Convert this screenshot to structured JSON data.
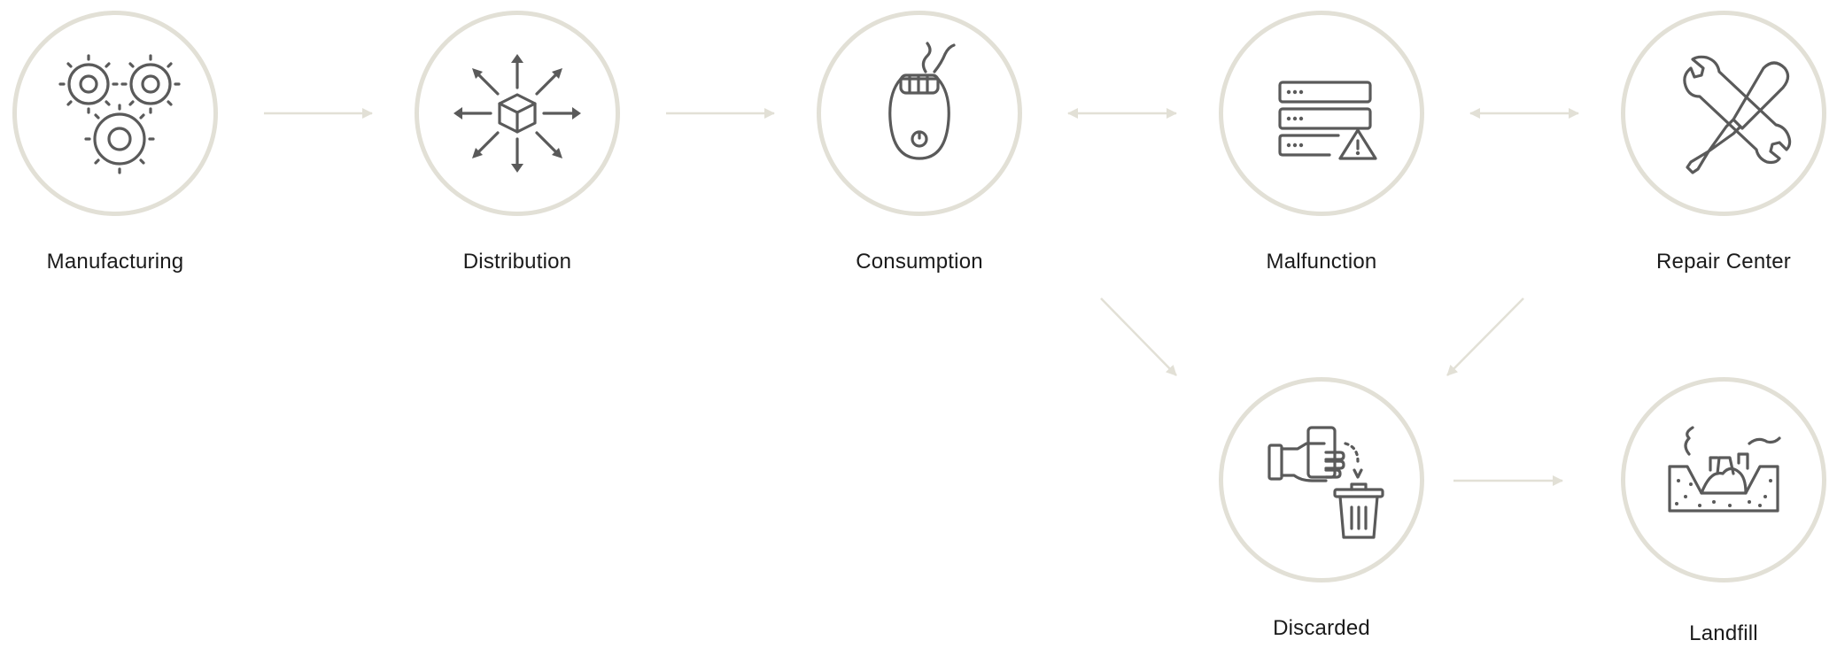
{
  "nodes": [
    {
      "id": "manufacturing",
      "label": "Manufacturing",
      "icon": "gears-icon"
    },
    {
      "id": "distribution",
      "label": "Distribution",
      "icon": "box-distribution-icon"
    },
    {
      "id": "consumption",
      "label": "Consumption",
      "icon": "epilator-icon"
    },
    {
      "id": "malfunction",
      "label": "Malfunction",
      "icon": "server-warning-icon"
    },
    {
      "id": "repair",
      "label": "Repair Center",
      "icon": "wrench-screwdriver-icon"
    },
    {
      "id": "discarded",
      "label": "Discarded",
      "icon": "hand-trash-icon"
    },
    {
      "id": "landfill",
      "label": "Landfill",
      "icon": "landfill-icon"
    }
  ],
  "edges": [
    {
      "from": "manufacturing",
      "to": "distribution",
      "type": "one-way"
    },
    {
      "from": "distribution",
      "to": "consumption",
      "type": "one-way"
    },
    {
      "from": "consumption",
      "to": "malfunction",
      "type": "two-way"
    },
    {
      "from": "malfunction",
      "to": "repair",
      "type": "two-way"
    },
    {
      "from": "consumption",
      "to": "discarded",
      "type": "one-way"
    },
    {
      "from": "repair",
      "to": "discarded",
      "type": "one-way"
    },
    {
      "from": "discarded",
      "to": "landfill",
      "type": "one-way"
    }
  ],
  "colors": {
    "circle_border": "#e2e0d6",
    "arrow": "#e2e0d6",
    "icon": "#5a5a5a",
    "text": "#1b1b1b"
  }
}
